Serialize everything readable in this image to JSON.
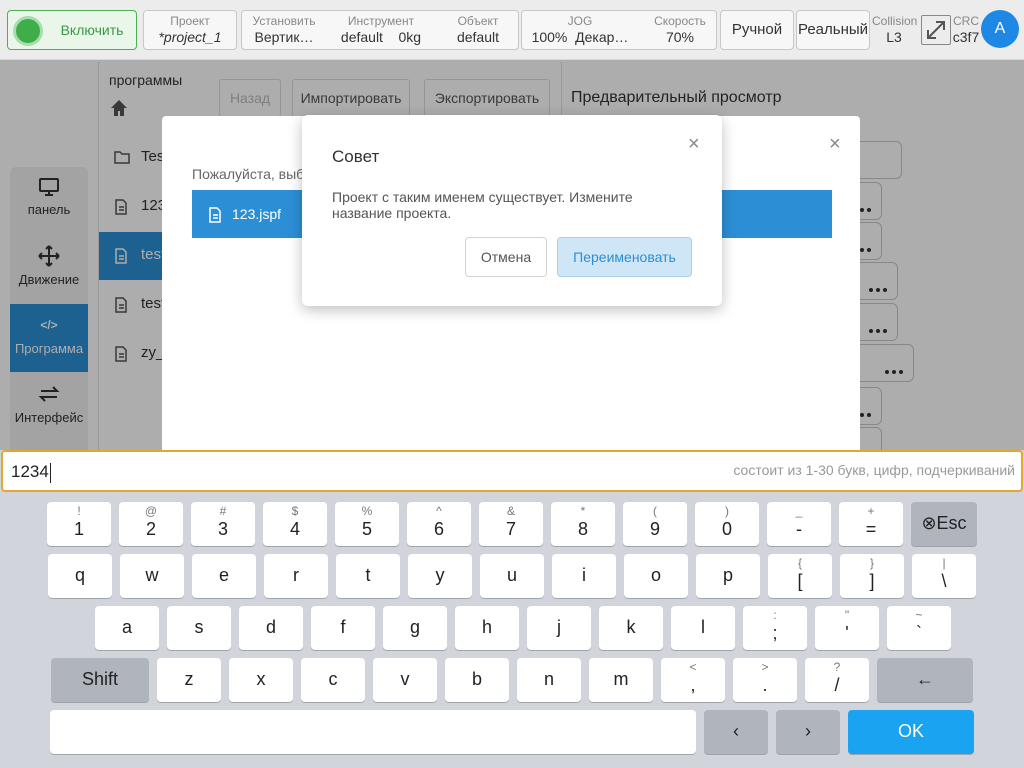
{
  "topbar": {
    "enable_label": "Включить",
    "project": {
      "caption": "Проект",
      "value": "*project_1"
    },
    "install": {
      "caption": "Установить",
      "value": "Вертик…"
    },
    "tool": {
      "caption": "Инструмент",
      "value1": "default",
      "value2": "0kg"
    },
    "object": {
      "caption": "Объект",
      "value": "default"
    },
    "jog": {
      "caption": "JOG",
      "value1": "100%",
      "value2": "Декар…"
    },
    "speed": {
      "caption": "Скорость",
      "value": "70%"
    },
    "manual_label": "Ручной",
    "real_label": "Реальный",
    "collision": {
      "caption": "Collision",
      "value": "L3"
    },
    "crc": {
      "caption": "CRC",
      "value": "c3f7"
    },
    "avatar_letter": "A"
  },
  "sidebar": {
    "items": [
      {
        "label": "панель",
        "icon": "monitor-icon"
      },
      {
        "label": "Движение",
        "icon": "move-icon"
      },
      {
        "label": "Программа",
        "icon": "code-icon",
        "active": true
      },
      {
        "label": "Интерфейс",
        "icon": "swap-icon"
      }
    ],
    "code_glyph": "</>"
  },
  "program_panel": {
    "title": "программы",
    "back_label": "Назад",
    "import_label": "Импортировать",
    "export_label": "Экспортировать",
    "files": [
      "Test",
      "123",
      "test",
      "test",
      "zy_"
    ],
    "preview_title": "Предварительный просмотр"
  },
  "open_dialog": {
    "hint": "Пожалуйста, выб",
    "selected_file": "123.jspf",
    "close": "×"
  },
  "tip_dialog": {
    "title": "Совет",
    "message": "Проект с таким именем существует. Измените название проекта.",
    "cancel_label": "Отмена",
    "rename_label": "Переименовать",
    "close": "×"
  },
  "keyboard": {
    "input_value": "1234",
    "input_hint": "состоит из 1-30 букв, цифр, подчеркиваний",
    "row1": [
      {
        "top": "!",
        "main": "1"
      },
      {
        "top": "@",
        "main": "2"
      },
      {
        "top": "#",
        "main": "3"
      },
      {
        "top": "$",
        "main": "4"
      },
      {
        "top": "%",
        "main": "5"
      },
      {
        "top": "^",
        "main": "6"
      },
      {
        "top": "&",
        "main": "7"
      },
      {
        "top": "*",
        "main": "8"
      },
      {
        "top": "(",
        "main": "9"
      },
      {
        "top": ")",
        "main": "0"
      },
      {
        "top": "_",
        "main": "-"
      },
      {
        "top": "+",
        "main": "="
      }
    ],
    "esc_label": "⊗Esc",
    "row2": [
      {
        "top": "",
        "main": "q"
      },
      {
        "top": "",
        "main": "w"
      },
      {
        "top": "",
        "main": "e"
      },
      {
        "top": "",
        "main": "r"
      },
      {
        "top": "",
        "main": "t"
      },
      {
        "top": "",
        "main": "y"
      },
      {
        "top": "",
        "main": "u"
      },
      {
        "top": "",
        "main": "i"
      },
      {
        "top": "",
        "main": "o"
      },
      {
        "top": "",
        "main": "p"
      },
      {
        "top": "{",
        "main": "["
      },
      {
        "top": "}",
        "main": "]"
      },
      {
        "top": "|",
        "main": "\\"
      }
    ],
    "row3": [
      {
        "top": "",
        "main": "a"
      },
      {
        "top": "",
        "main": "s"
      },
      {
        "top": "",
        "main": "d"
      },
      {
        "top": "",
        "main": "f"
      },
      {
        "top": "",
        "main": "g"
      },
      {
        "top": "",
        "main": "h"
      },
      {
        "top": "",
        "main": "j"
      },
      {
        "top": "",
        "main": "k"
      },
      {
        "top": "",
        "main": "l"
      },
      {
        "top": ":",
        "main": ";"
      },
      {
        "top": "\"",
        "main": "'"
      },
      {
        "top": "~",
        "main": "`"
      }
    ],
    "shift_label": "Shift",
    "row4": [
      {
        "top": "",
        "main": "z"
      },
      {
        "top": "",
        "main": "x"
      },
      {
        "top": "",
        "main": "c"
      },
      {
        "top": "",
        "main": "v"
      },
      {
        "top": "",
        "main": "b"
      },
      {
        "top": "",
        "main": "n"
      },
      {
        "top": "",
        "main": "m"
      },
      {
        "top": "<",
        "main": ","
      },
      {
        "top": ">",
        "main": "."
      },
      {
        "top": "?",
        "main": "/"
      }
    ],
    "backspace_label": "←",
    "left_label": "‹",
    "right_label": "›",
    "ok_label": "OK"
  },
  "colors": {
    "accent": "#2c8fd6",
    "enable_green": "#3fae49",
    "input_border": "#e0a82e",
    "ok_blue": "#1aa3f1"
  }
}
